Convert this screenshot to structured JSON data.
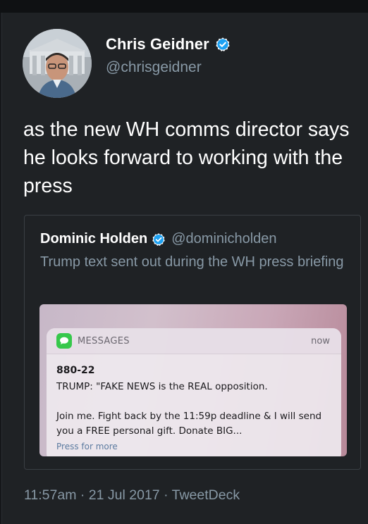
{
  "tweet": {
    "author_name": "Chris Geidner",
    "author_handle": "@chrisgeidner",
    "text": "as the new WH comms director says he looks forward to working with the press",
    "time": "11:57am",
    "date": "21 Jul 2017",
    "client": "TweetDeck",
    "separator": "·"
  },
  "quoted_tweet": {
    "author_name": "Dominic Holden",
    "author_handle": "@dominicholden",
    "text": "Trump text sent out during the WH press briefing",
    "notification": {
      "app_name": "MESSAGES",
      "time": "now",
      "sender": "880-22",
      "line1": "TRUMP: \"FAKE NEWS is the REAL opposition.",
      "line2": "Join me. Fight back by the 11:59p deadline & I will send you a FREE personal gift. Donate BIG...",
      "action": "Press for more"
    }
  },
  "colors": {
    "background": "#1f2225",
    "text_primary": "#ffffff",
    "text_secondary": "#8899a6",
    "verified_blue": "#1da1f2",
    "messages_green": "#36c84b"
  },
  "icons": {
    "verified": "verified-badge-icon",
    "messages_app": "speech-bubble-icon"
  }
}
